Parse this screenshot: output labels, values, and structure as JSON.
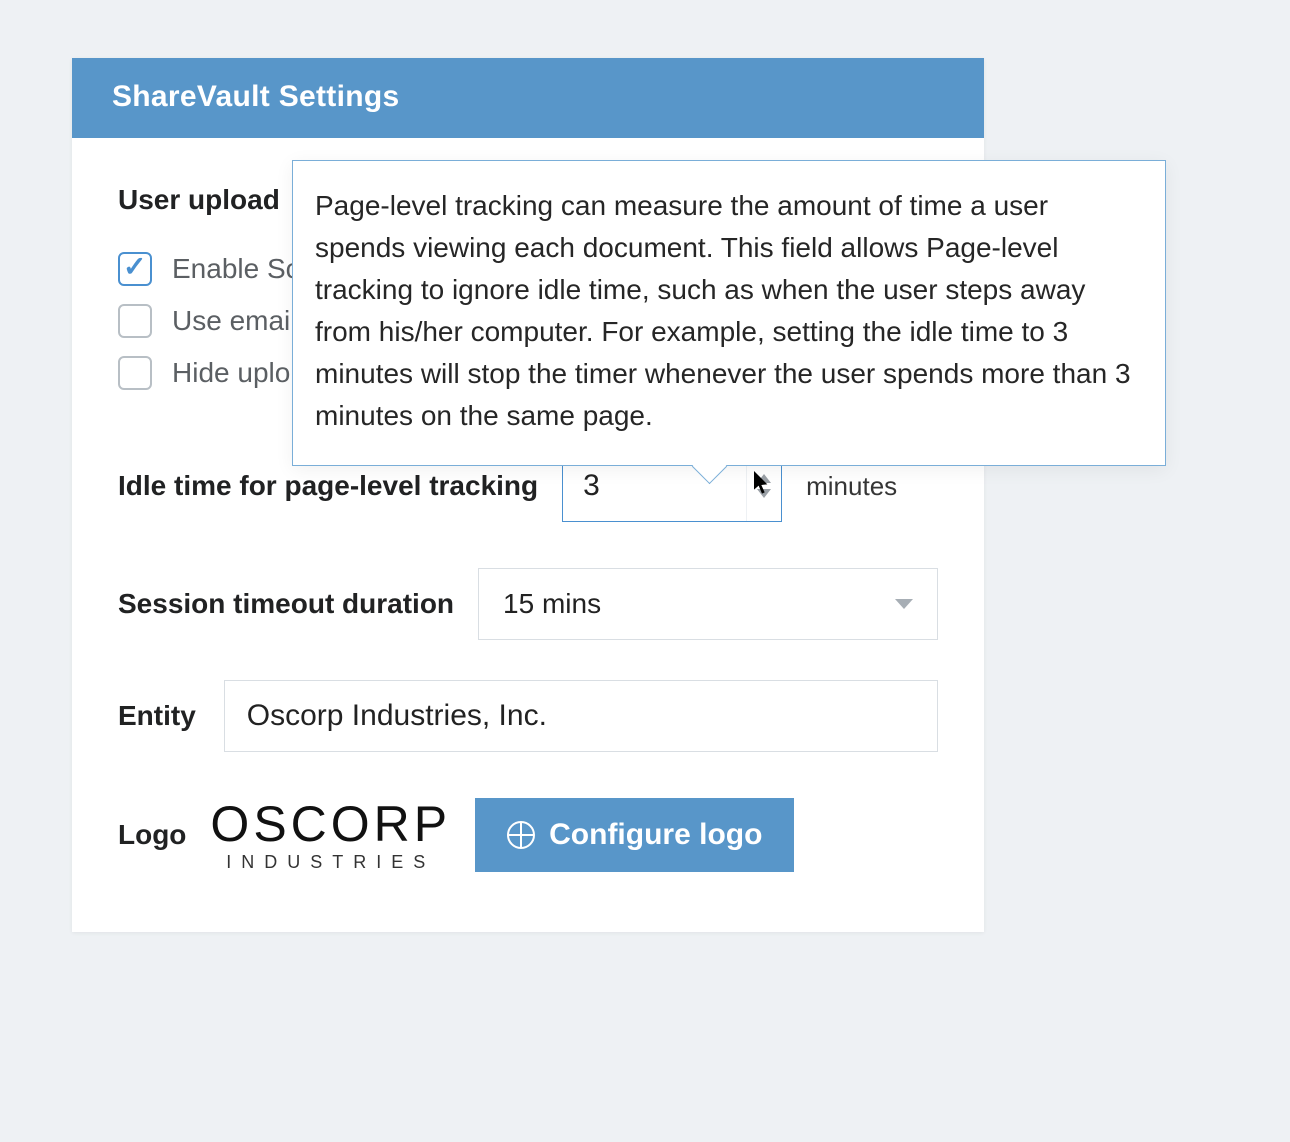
{
  "header": {
    "title": "ShareVault Settings"
  },
  "section": {
    "user_upload_label": "User upload"
  },
  "checkboxes": {
    "enable_screen_capture": {
      "label": "Enable Sc",
      "checked": true
    },
    "use_email": {
      "label": "Use emai",
      "checked": false
    },
    "hide_upload": {
      "label": "Hide uplo",
      "checked": false
    }
  },
  "idle_time": {
    "label": "Idle time for page-level tracking",
    "value": "3",
    "unit": "minutes"
  },
  "session_timeout": {
    "label": "Session timeout duration",
    "value": "15 mins"
  },
  "entity": {
    "label": "Entity",
    "value": "Oscorp Industries, Inc."
  },
  "logo": {
    "label": "Logo",
    "mark_top": "OSCORP",
    "mark_bottom": "INDUSTRIES",
    "button": "Configure logo"
  },
  "tooltip": {
    "text": "Page-level tracking can measure the amount of time a user spends viewing each document. This field allows Page-level tracking to ignore idle time, such as when the user steps away from his/her computer. For example, setting the idle time to 3 minutes will stop the timer whenever the user spends more than 3 minutes on the same page."
  },
  "colors": {
    "accent": "#5896c9"
  }
}
